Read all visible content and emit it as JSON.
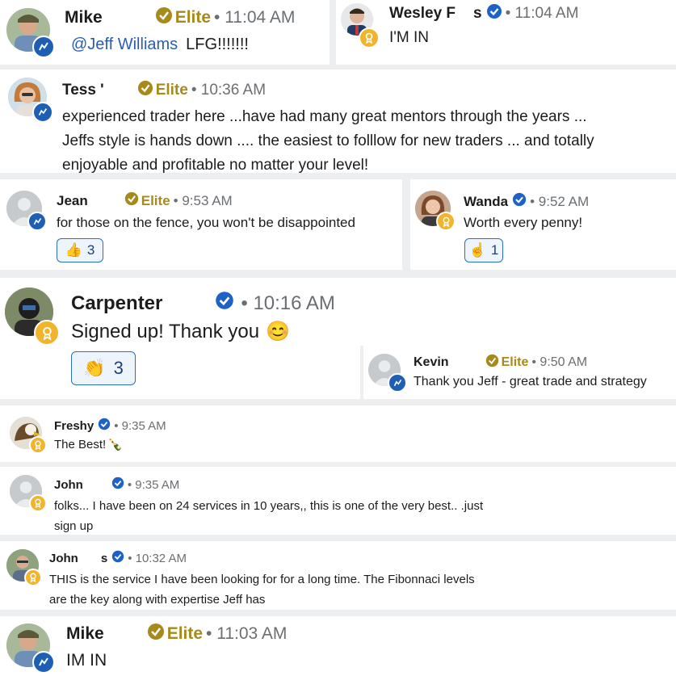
{
  "posts": [
    {
      "name": "Mike ",
      "tier": "Elite",
      "time": "• 11:04 AM",
      "mention": "@Jeff Williams",
      "text": "LFG!!!!!!!"
    },
    {
      "name": "Wesley F",
      "name_tail": "s",
      "time": "• 11:04 AM",
      "text": "I'M IN"
    },
    {
      "name": "Tess '",
      "tier": "Elite",
      "time": "• 10:36 AM",
      "lines": [
        "experienced trader here ...have had many great mentors through the years ...",
        "Jeffs style is hands down .... the easiest to folllow for new traders ... and totally",
        "enjoyable and profitable no matter your level!"
      ]
    },
    {
      "name": "Jean",
      "tier": "Elite",
      "time": "• 9:53 AM",
      "text": "for those on the fence, you won't be disappointed",
      "reaction": {
        "emoji": "👍",
        "count": "3"
      }
    },
    {
      "name": "Wanda",
      "time": "• 9:52 AM",
      "text": "Worth every penny!",
      "reaction": {
        "emoji": "☝",
        "count": "1"
      }
    },
    {
      "name": "Carpenter",
      "time": "• 10:16 AM",
      "text": "Signed up! Thank you",
      "emoji": "😊",
      "reaction": {
        "emoji": "👏",
        "count": "3"
      }
    },
    {
      "name": "Kevin",
      "tier": "Elite",
      "time": "• 9:50 AM",
      "text": "Thank you Jeff - great trade and strategy"
    },
    {
      "name": "Freshy",
      "time": "• 9:35 AM",
      "text": "The Best!",
      "emoji": "🍾"
    },
    {
      "name": "John ",
      "time": "• 9:35 AM",
      "lines": [
        "folks... I have been on 24 services in 10 years,, this is one of the very best.. .just",
        "sign up"
      ]
    },
    {
      "name": "John ",
      "name_tail": "s",
      "time": "• 10:32 AM",
      "lines": [
        "THIS is the service I have been looking for for a long time. The Fibonnaci levels",
        "are the key along with expertise Jeff has"
      ]
    },
    {
      "name": "Mike ",
      "tier": "Elite",
      "time": "• 11:03 AM",
      "text": "IM IN"
    }
  ],
  "colors": {
    "verified": "#1d63c7",
    "elite": "#a78a1c",
    "gold": "#f1b52d",
    "blue_badge": "#1d5fb3"
  }
}
